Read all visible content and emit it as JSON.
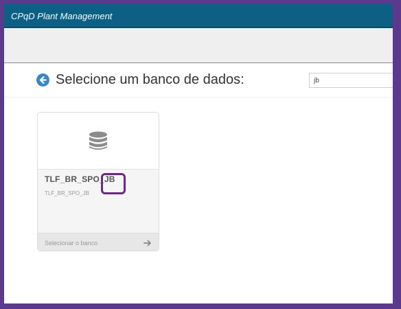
{
  "app": {
    "title": "CPqD Plant Management"
  },
  "header": {
    "title": "Selecione um banco de dados:",
    "search_value": "jb",
    "back_icon": "arrow-left-circle-icon"
  },
  "databases": [
    {
      "name": "TLF_BR_SPO_JB",
      "subname": "TLF_BR_SPO_JB",
      "icon": "database-icon",
      "action_label": "Selecionar o banco",
      "action_icon": "arrow-right-icon"
    }
  ],
  "colors": {
    "titlebar": "#0d5f84",
    "background": "#5b3a8e",
    "accent": "#3a87c8",
    "highlight": "#6a2a82"
  }
}
